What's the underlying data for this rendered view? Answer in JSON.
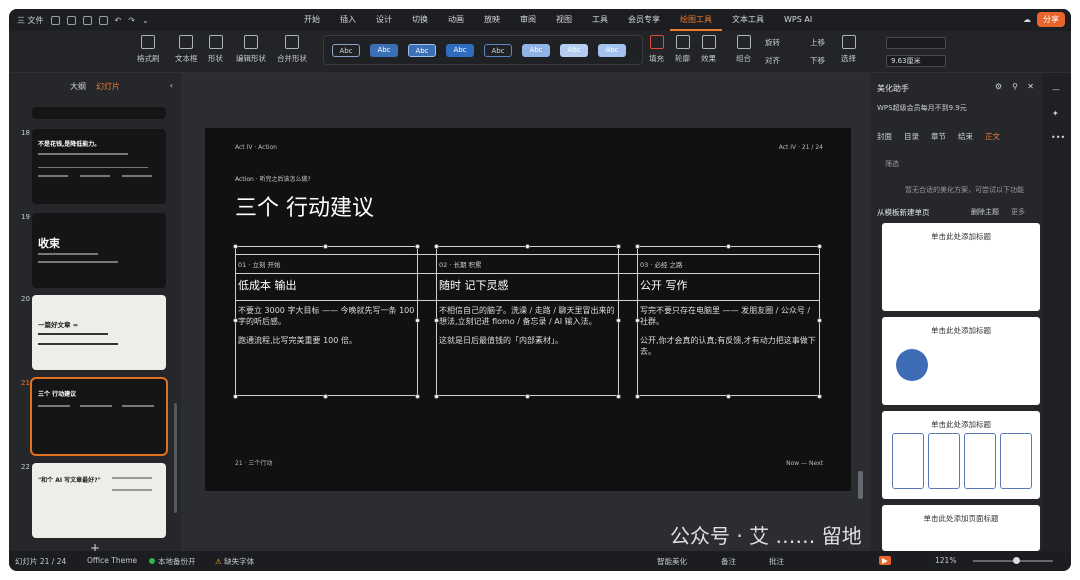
{
  "menubar": {
    "file_label": "三 文件",
    "tabs": [
      "开始",
      "插入",
      "设计",
      "切换",
      "动画",
      "放映",
      "审阅",
      "视图",
      "工具",
      "会员专享",
      "绘图工具",
      "文本工具",
      "WPS AI"
    ],
    "active_tab": "绘图工具",
    "share_label": "分享"
  },
  "toolbar": {
    "format_brush": "格式刷",
    "textbox": "文本框",
    "shape": "形状",
    "edit_shape": "编辑形状",
    "merge_shape": "合并形状",
    "style_label": "Abc",
    "fill": "填充",
    "outline": "轮廓",
    "effect": "效果",
    "group": "组合",
    "rotate": "旋转",
    "align": "对齐",
    "move_up": "上移",
    "move_down": "下移",
    "select": "选择",
    "height_value": "",
    "width_value": "9.63厘米"
  },
  "left_panel": {
    "tab_outline": "大纲",
    "tab_slides": "幻灯片",
    "add_label": "+",
    "slides": [
      {
        "num": "18",
        "title": "不是花钱,是降低能力。"
      },
      {
        "num": "19",
        "title": "收束"
      },
      {
        "num": "20",
        "title": "一篇好文章 ="
      },
      {
        "num": "21",
        "title": "三个 行动建议"
      },
      {
        "num": "22",
        "title": "\"和个 AI 写文章最好?\""
      }
    ]
  },
  "slide": {
    "top_left": "Act IV · Action",
    "top_right": "Act IV · 21 / 24",
    "kicker": "Action · 听完之后该怎么做?",
    "title": "三个 行动建议",
    "footer_left": "21 · 三个行动",
    "footer_right": "Now — Next",
    "columns": [
      {
        "label": "01 · 立刻 开始",
        "heading": "低成本 输出",
        "body1": "不要立 3000 字大目标 —— 今晚就先写一条 100 字的听后感。",
        "body2": "跑通流程,比写完美重要 100 倍。"
      },
      {
        "label": "02 · 长期 积累",
        "heading": "随时 记下灵感",
        "body1": "不相信自己的脑子。洗澡 / 走路 / 聊天里冒出来的想法,立刻记进 flomo / 备忘录 / AI 输入法。",
        "body2": "这就是日后最值钱的「内部素材」。"
      },
      {
        "label": "03 · 必经 之路",
        "heading": "公开 写作",
        "body1": "写完不要只存在电脑里 —— 发朋友圈 / 公众号 / 社群。",
        "body2": "公开,你才会真的认真;有反馈,才有动力把这事做下去。"
      }
    ]
  },
  "right_panel": {
    "title": "美化助手",
    "promo": "WPS超级会员每月不到9.9元",
    "tabs": [
      "封面",
      "目录",
      "章节",
      "结束",
      "正文"
    ],
    "active_tab": "正文",
    "filter": "筛选",
    "empty_hint": "暂无合适的美化方案，可尝试以下功能",
    "new_from_template": "从模板新建单页",
    "delete_theme": "删除主题",
    "more": "更多",
    "template_titles": [
      "单击此处添加标题",
      "单击此处添加标题",
      "单击此处添加标题",
      "单击此处添加页面标题"
    ]
  },
  "statusbar": {
    "slide_count": "幻灯片 21 / 24",
    "theme": "Office Theme",
    "backup": "本地备份开",
    "missing_font": "缺失字体",
    "smart_beautify": "智能美化",
    "notes": "备注",
    "comments": "批注",
    "zoom": "121%"
  },
  "watermark": "公众号 · 艾 …… 留地"
}
